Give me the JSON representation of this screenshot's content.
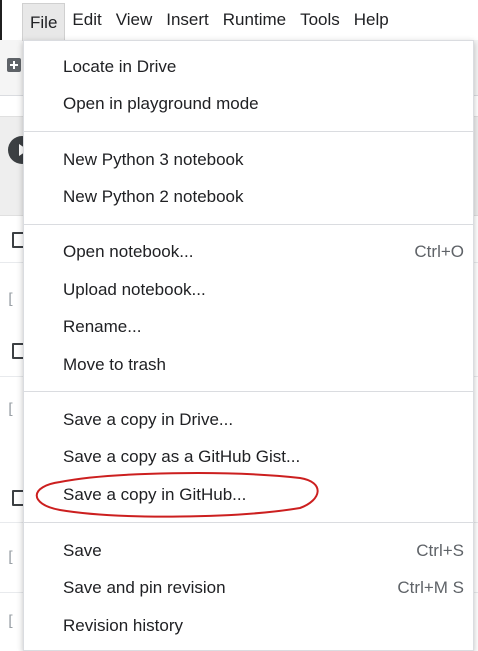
{
  "menubar": {
    "items": [
      {
        "label": "File",
        "active": true
      },
      {
        "label": "Edit",
        "active": false
      },
      {
        "label": "View",
        "active": false
      },
      {
        "label": "Insert",
        "active": false
      },
      {
        "label": "Runtime",
        "active": false
      },
      {
        "label": "Tools",
        "active": false
      },
      {
        "label": "Help",
        "active": false
      }
    ]
  },
  "file_menu": {
    "groups": [
      [
        {
          "label": "Locate in Drive"
        },
        {
          "label": "Open in playground mode"
        }
      ],
      [
        {
          "label": "New Python 3 notebook"
        },
        {
          "label": "New Python 2 notebook"
        }
      ],
      [
        {
          "label": "Open notebook...",
          "shortcut": "Ctrl+O"
        },
        {
          "label": "Upload notebook..."
        },
        {
          "label": "Rename..."
        },
        {
          "label": "Move to trash"
        }
      ],
      [
        {
          "label": "Save a copy in Drive..."
        },
        {
          "label": "Save a copy as a GitHub Gist..."
        },
        {
          "label": "Save a copy in GitHub...",
          "highlighted": true
        }
      ],
      [
        {
          "label": "Save",
          "shortcut": "Ctrl+S"
        },
        {
          "label": "Save and pin revision",
          "shortcut": "Ctrl+M S"
        },
        {
          "label": "Revision history"
        }
      ]
    ]
  },
  "background": {
    "cell_bracket": "["
  },
  "annotation": {
    "color": "#cc1f1f",
    "shape": "hand-drawn-ellipse",
    "target": "Save a copy in GitHub..."
  },
  "icons": {
    "add_cell": "plus-icon",
    "run_cell": "play-icon"
  }
}
